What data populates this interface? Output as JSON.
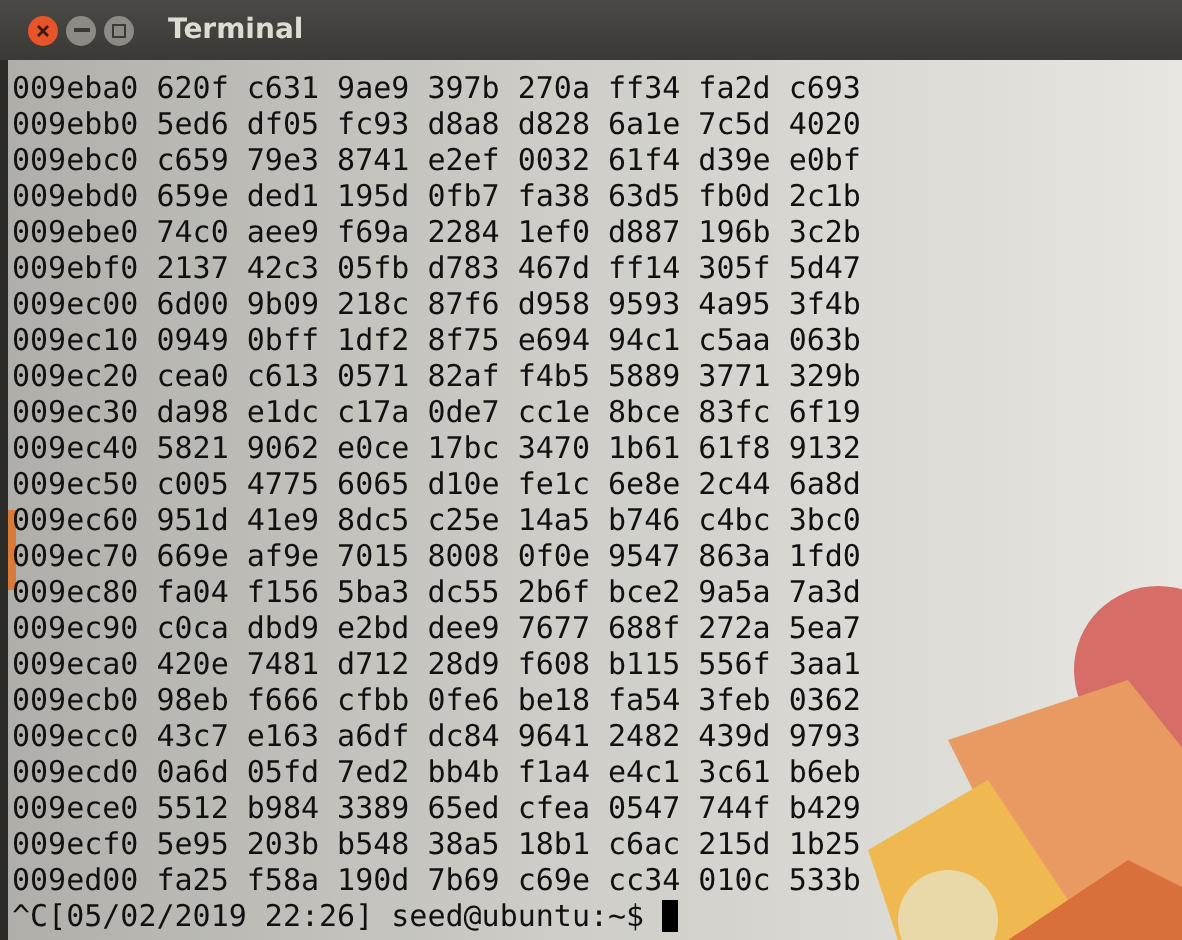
{
  "window": {
    "title": "Terminal"
  },
  "lines": [
    "009eba0 620f c631 9ae9 397b 270a ff34 fa2d c693",
    "009ebb0 5ed6 df05 fc93 d8a8 d828 6a1e 7c5d 4020",
    "009ebc0 c659 79e3 8741 e2ef 0032 61f4 d39e e0bf",
    "009ebd0 659e ded1 195d 0fb7 fa38 63d5 fb0d 2c1b",
    "009ebe0 74c0 aee9 f69a 2284 1ef0 d887 196b 3c2b",
    "009ebf0 2137 42c3 05fb d783 467d ff14 305f 5d47",
    "009ec00 6d00 9b09 218c 87f6 d958 9593 4a95 3f4b",
    "009ec10 0949 0bff 1df2 8f75 e694 94c1 c5aa 063b",
    "009ec20 cea0 c613 0571 82af f4b5 5889 3771 329b",
    "009ec30 da98 e1dc c17a 0de7 cc1e 8bce 83fc 6f19",
    "009ec40 5821 9062 e0ce 17bc 3470 1b61 61f8 9132",
    "009ec50 c005 4775 6065 d10e fe1c 6e8e 2c44 6a8d",
    "009ec60 951d 41e9 8dc5 c25e 14a5 b746 c4bc 3bc0",
    "009ec70 669e af9e 7015 8008 0f0e 9547 863a 1fd0",
    "009ec80 fa04 f156 5ba3 dc55 2b6f bce2 9a5a 7a3d",
    "009ec90 c0ca dbd9 e2bd dee9 7677 688f 272a 5ea7",
    "009eca0 420e 7481 d712 28d9 f608 b115 556f 3aa1",
    "009ecb0 98eb f666 cfbb 0fe6 be18 fa54 3feb 0362",
    "009ecc0 43c7 e163 a6df dc84 9641 2482 439d 9793",
    "009ecd0 0a6d 05fd 7ed2 bb4b f1a4 e4c1 3c61 b6eb",
    "009ece0 5512 b984 3389 65ed cfea 0547 744f b429",
    "009ecf0 5e95 203b b548 38a5 18b1 c6ac 215d 1b25",
    "009ed00 fa25 f58a 190d 7b69 c69e cc34 010c 533b"
  ],
  "prompt": "^C[05/02/2019 22:26] seed@ubuntu:~$"
}
